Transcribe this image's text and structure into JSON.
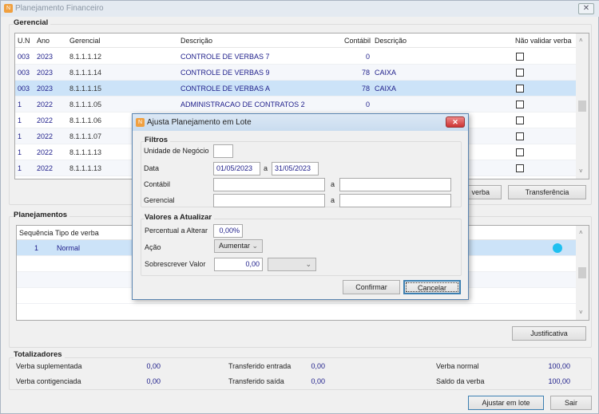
{
  "window": {
    "title": "Planejamento Financeiro",
    "close": "☒"
  },
  "gerencial": {
    "title": "Gerencial",
    "columns": [
      "U.N",
      "Ano",
      "Gerencial",
      "Descrição",
      "Contábil",
      "Descrição",
      "Não validar verba"
    ],
    "rows": [
      {
        "un": "003",
        "ano": "2023",
        "gerencial": "8.1.1.1.12",
        "descricao": "CONTROLE DE VERBAS 7",
        "contabil": "0",
        "descricao2": "",
        "nao_validar": false
      },
      {
        "un": "003",
        "ano": "2023",
        "gerencial": "8.1.1.1.14",
        "descricao": "CONTROLE DE VERBAS 9",
        "contabil": "78",
        "descricao2": "CAIXA",
        "nao_validar": false
      },
      {
        "un": "003",
        "ano": "2023",
        "gerencial": "8.1.1.1.15",
        "descricao": "CONTROLE DE VERBAS A",
        "contabil": "78",
        "descricao2": "CAIXA",
        "nao_validar": false,
        "selected": true
      },
      {
        "un": "1",
        "ano": "2022",
        "gerencial": "8.1.1.1.05",
        "descricao": "ADMINISTRACAO DE CONTRATOS 2",
        "contabil": "0",
        "descricao2": "",
        "nao_validar": false
      },
      {
        "un": "1",
        "ano": "2022",
        "gerencial": "8.1.1.1.06",
        "descricao": "",
        "contabil": "",
        "descricao2": "",
        "nao_validar": false
      },
      {
        "un": "1",
        "ano": "2022",
        "gerencial": "8.1.1.1.07",
        "descricao": "",
        "contabil": "",
        "descricao2": "",
        "nao_validar": false
      },
      {
        "un": "1",
        "ano": "2022",
        "gerencial": "8.1.1.1.13",
        "descricao": "",
        "contabil": "",
        "descricao2": "",
        "nao_validar": false
      },
      {
        "un": "1",
        "ano": "2022",
        "gerencial": "8.1.1.1.13",
        "descricao": "",
        "contabil": "",
        "descricao2": "",
        "nao_validar": false
      }
    ],
    "buttons": {
      "verba": "verba",
      "transferencia": "Transferência"
    }
  },
  "planejamentos": {
    "title": "Planejamentos",
    "columns": [
      "Sequência",
      "Tipo de verba"
    ],
    "rows": [
      {
        "sequencia": "1",
        "tipo": "Normal",
        "status_color": "#1ec0f0"
      }
    ],
    "justificativa": "Justificativa"
  },
  "totalizadores": {
    "title": "Totalizadores",
    "items": [
      {
        "label": "Verba suplementada",
        "value": "0,00"
      },
      {
        "label": "Transferido entrada",
        "value": "0,00"
      },
      {
        "label": "Verba normal",
        "value": "100,00"
      },
      {
        "label": "Verba contigenciada",
        "value": "0,00"
      },
      {
        "label": "Transferido saída",
        "value": "0,00"
      },
      {
        "label": "Saldo da verba",
        "value": "100,00"
      }
    ]
  },
  "footer": {
    "ajustar": "Ajustar em lote",
    "sair": "Sair"
  },
  "dialog": {
    "title": "Ajusta Planejamento em Lote",
    "filtros": {
      "title": "Filtros",
      "unidade_label": "Unidade de Negócio",
      "unidade_value": "",
      "data_label": "Data",
      "data_from": "01/05/2023",
      "sep": "a",
      "data_to": "31/05/2023",
      "contabil_label": "Contábil",
      "contabil_from": "",
      "contabil_to": "",
      "gerencial_label": "Gerencial",
      "gerencial_from": "",
      "gerencial_to": ""
    },
    "valores": {
      "title": "Valores a Atualizar",
      "percentual_label": "Percentual a Alterar",
      "percentual_value": "0,00%",
      "acao_label": "Ação",
      "acao_value": "Aumentar",
      "sobrescrever_label": "Sobrescrever Valor",
      "sobrescrever_value": "0,00",
      "sobrescrever_select": ""
    },
    "confirmar": "Confirmar",
    "cancelar": "Cancelar"
  }
}
